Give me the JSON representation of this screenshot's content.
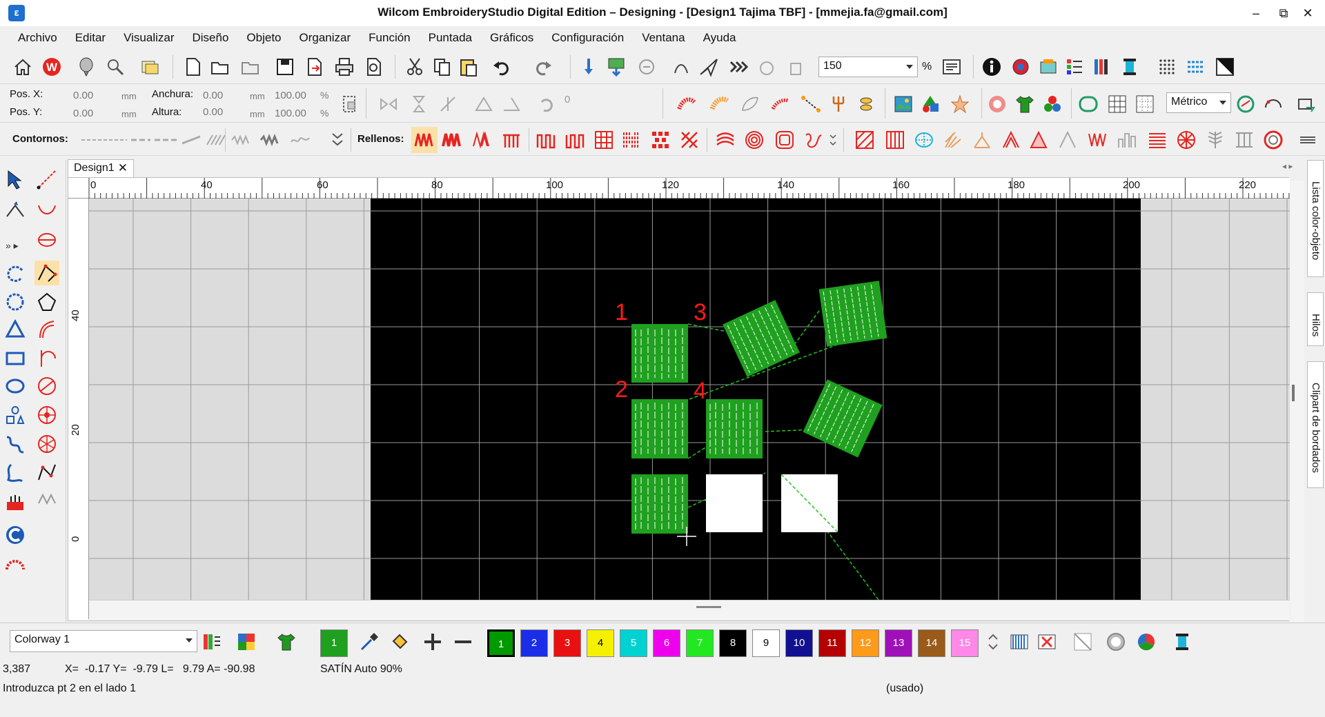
{
  "window": {
    "title": "Wilcom EmbroideryStudio Digital Edition – Designing - [Design1           Tajima TBF] - [mmejia.fa@gmail.com]",
    "minimize": "–",
    "restore": "⧉",
    "close": "✕"
  },
  "menu": [
    "Archivo",
    "Editar",
    "Visualizar",
    "Diseño",
    "Objeto",
    "Organizar",
    "Función",
    "Puntada",
    "Gráficos",
    "Configuración",
    "Ventana",
    "Ayuda"
  ],
  "toolbar": {
    "zoom_value": "150",
    "zoom_unit": "%",
    "units_value": "Métrico",
    "angle_value": "0"
  },
  "props": {
    "pos_x_label": "Pos. X:",
    "pos_y_label": "Pos. Y:",
    "pos_x_value": "0.00",
    "pos_y_value": "0.00",
    "width_label": "Anchura:",
    "height_label": "Altura:",
    "width_value": "0.00",
    "height_value": "0.00",
    "unit": "mm",
    "scale_w": "100.00",
    "scale_h": "100.00",
    "pct": "%"
  },
  "fill_bar": {
    "contornos_label": "Contornos:",
    "rellenos_label": "Rellenos:"
  },
  "document": {
    "tab_label": "Design1",
    "close_glyph": "✕"
  },
  "ruler": {
    "h_ticks": [
      "0",
      "40",
      "60",
      "80",
      "100",
      "120",
      "140",
      "160",
      "180",
      "200",
      "220"
    ],
    "v_ticks": [
      "40",
      "20",
      "0"
    ]
  },
  "annotations": [
    "1",
    "2",
    "3",
    "4"
  ],
  "dockers": [
    "Lista color-objeto",
    "Hilos",
    "Clipart de bordados"
  ],
  "colorway": {
    "value": "Colorway 1",
    "current_thread": "1",
    "swatches": [
      {
        "label": "1",
        "color": "#009a00",
        "text": "#ffffff"
      },
      {
        "label": "2",
        "color": "#1a2ee8",
        "text": "#ffffff"
      },
      {
        "label": "3",
        "color": "#e81010",
        "text": "#ffffff"
      },
      {
        "label": "4",
        "color": "#f5f000",
        "text": "#000000"
      },
      {
        "label": "5",
        "color": "#00d2d2",
        "text": "#ffffff"
      },
      {
        "label": "6",
        "color": "#ee00ee",
        "text": "#ffffff"
      },
      {
        "label": "7",
        "color": "#22e822",
        "text": "#ffffff"
      },
      {
        "label": "8",
        "color": "#000000",
        "text": "#ffffff"
      },
      {
        "label": "9",
        "color": "#ffffff",
        "text": "#000000"
      },
      {
        "label": "10",
        "color": "#101090",
        "text": "#ffffff"
      },
      {
        "label": "11",
        "color": "#b40000",
        "text": "#ffffff"
      },
      {
        "label": "12",
        "color": "#ff9a1a",
        "text": "#ffffff"
      },
      {
        "label": "13",
        "color": "#a010b8",
        "text": "#ffffff"
      },
      {
        "label": "14",
        "color": "#9a5a1a",
        "text": "#ffffff"
      },
      {
        "label": "15",
        "color": "#ff88e8",
        "text": "#ffffff"
      }
    ]
  },
  "status": {
    "count": "3,387",
    "coords": "X=  -0.17 Y=  -9.79 L=   9.79 A= -90.98",
    "stitch_type": "SATÍN Auto 90%",
    "prompt": "Introduzca pt 2 en el lado 1",
    "usage": "(usado)"
  },
  "colors": {
    "design_bg": "#000000",
    "stitch_green": "#1fa01f",
    "annotation_red": "#ff1a1a"
  }
}
